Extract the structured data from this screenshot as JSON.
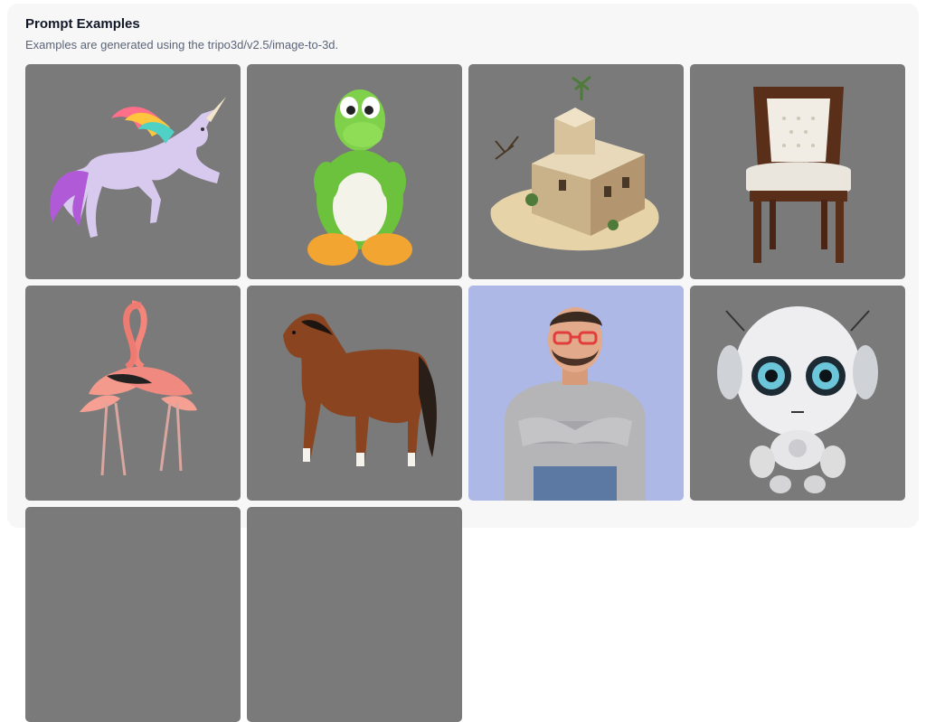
{
  "header": {
    "title": "Prompt Examples",
    "subtitle": "Examples are generated using the tripo3d/v2.5/image-to-3d."
  },
  "examples": [
    {
      "subject": "unicorn-icon",
      "background": "#7a7a7a"
    },
    {
      "subject": "plush-dinosaur-icon",
      "background": "#7a7a7a"
    },
    {
      "subject": "desert-house-icon",
      "background": "#7a7a7a"
    },
    {
      "subject": "chair-icon",
      "background": "#7a7a7a"
    },
    {
      "subject": "flamingos-icon",
      "background": "#7a7a7a"
    },
    {
      "subject": "horse-icon",
      "background": "#7a7a7a"
    },
    {
      "subject": "man-avatar-icon",
      "background": "#aeb8e6"
    },
    {
      "subject": "robot-icon",
      "background": "#7a7a7a"
    },
    {
      "subject": "",
      "background": "#7a7a7a"
    },
    {
      "subject": "",
      "background": "#7a7a7a"
    }
  ]
}
